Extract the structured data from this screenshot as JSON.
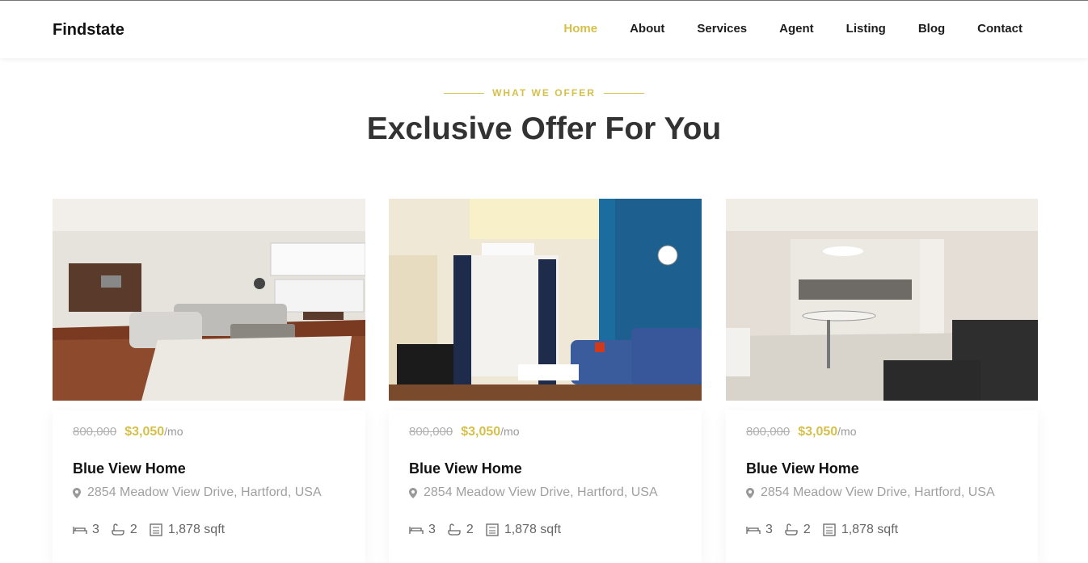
{
  "brand": "Findstate",
  "nav": [
    {
      "label": "Home",
      "active": true
    },
    {
      "label": "About"
    },
    {
      "label": "Services"
    },
    {
      "label": "Agent"
    },
    {
      "label": "Listing"
    },
    {
      "label": "Blog"
    },
    {
      "label": "Contact"
    }
  ],
  "section": {
    "eyebrow": "WHAT WE OFFER",
    "title": "Exclusive Offer For You"
  },
  "colors": {
    "accent": "#d4c04a"
  },
  "listings": [
    {
      "old_price": "800,000",
      "price": "$3,050",
      "per": "/mo",
      "title": "Blue View Home",
      "address": "2854 Meadow View Drive, Hartford, USA",
      "beds": "3",
      "baths": "2",
      "area": "1,878 sqft"
    },
    {
      "old_price": "800,000",
      "price": "$3,050",
      "per": "/mo",
      "title": "Blue View Home",
      "address": "2854 Meadow View Drive, Hartford, USA",
      "beds": "3",
      "baths": "2",
      "area": "1,878 sqft"
    },
    {
      "old_price": "800,000",
      "price": "$3,050",
      "per": "/mo",
      "title": "Blue View Home",
      "address": "2854 Meadow View Drive, Hartford, USA",
      "beds": "3",
      "baths": "2",
      "area": "1,878 sqft"
    }
  ]
}
